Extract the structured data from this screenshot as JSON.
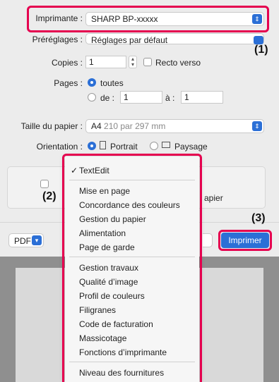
{
  "printer": {
    "label": "Imprimante :",
    "value": "SHARP BP-xxxxx"
  },
  "presets": {
    "label": "Préréglages :",
    "value": "Réglages par défaut"
  },
  "copies": {
    "label": "Copies :",
    "value": "1",
    "duplex_label": "Recto verso"
  },
  "pages": {
    "label": "Pages :",
    "all_label": "toutes",
    "from_label": "de :",
    "from_value": "1",
    "to_label": "à :",
    "to_value": "1"
  },
  "paper_size": {
    "label": "Taille du papier :",
    "value_main": "A4",
    "value_detail": "210 par 297 mm"
  },
  "orientation": {
    "label": "Orientation :",
    "portrait_label": "Portrait",
    "landscape_label": "Paysage"
  },
  "hidden_option_text": "apier",
  "pdf_button": "PDF",
  "print_button": "Imprimer",
  "callouts": {
    "c1": "(1)",
    "c2": "(2)",
    "c3": "(3)"
  },
  "menu": {
    "check_mark": "✓",
    "group1": [
      "TextEdit"
    ],
    "group2": [
      "Mise en page",
      "Concordance des couleurs",
      "Gestion du papier",
      "Alimentation",
      "Page de garde"
    ],
    "group3": [
      "Gestion travaux",
      "Qualité d’image",
      "Profil de couleurs",
      "Filigranes",
      "Code de facturation",
      "Massicotage",
      "Fonctions d’imprimante"
    ],
    "group4": [
      "Niveau des fournitures"
    ]
  },
  "colors": {
    "accent": "#2b6fd6",
    "highlight": "#e5004f"
  }
}
